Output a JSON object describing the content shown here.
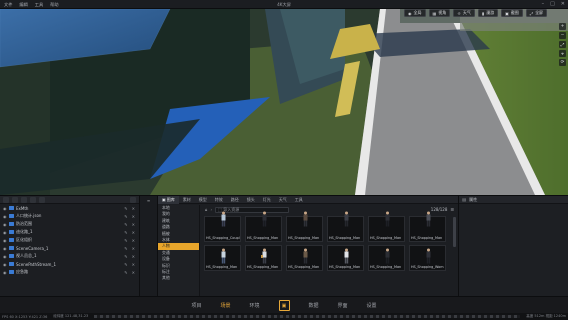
{
  "titlebar": {
    "menu": [
      "文件",
      "编辑",
      "工具",
      "帮助"
    ],
    "title": "4K大屏",
    "controls": [
      "–",
      "□",
      "✕"
    ]
  },
  "viewport": {
    "top_buttons": [
      {
        "icon": "camera-icon",
        "label": "全局"
      },
      {
        "icon": "grid-icon",
        "label": "视角"
      },
      {
        "icon": "sun-icon",
        "label": "天气"
      },
      {
        "icon": "bookmark-icon",
        "label": "漫游"
      },
      {
        "icon": "photo-icon",
        "label": "截图"
      },
      {
        "icon": "expand-icon",
        "label": "全屏"
      }
    ],
    "side_buttons": [
      "+",
      "−",
      "⤢",
      "⌖",
      "⟳"
    ]
  },
  "scene_panel": {
    "items": [
      "ExMth",
      "人口统计.json",
      "防治范围",
      "迪化路_1",
      "区化组织",
      "SceneCamera_1",
      "视人员总_1",
      "ScenePathStream_1",
      "应急路"
    ]
  },
  "library": {
    "tabs": [
      "图库",
      "素材",
      "模型",
      "特效",
      "路径",
      "镜头",
      "灯光",
      "天气",
      "工具"
    ],
    "active_tab": 0,
    "categories": [
      "本地",
      "我的",
      "建筑",
      "道路",
      "植被",
      "水体",
      "人物",
      "交通",
      "设备",
      "标识",
      "标注",
      "其他"
    ],
    "active_category": 6,
    "search_placeholder": "导入资源",
    "count": "128/128",
    "assets": [
      "HS_Shopping_Coupl",
      "HS_Shopping_Man",
      "HS_Shopping_Man",
      "HS_Shopping_Man",
      "HS_Shopping_Man",
      "HS_Shopping_Man",
      "HS_Shopping_Man",
      "HS_Shopping_Man",
      "HS_Shopping_Man",
      "HS_Shopping_Man",
      "HS_Shopping_Man",
      "HS_Shopping_Wom"
    ]
  },
  "properties": {
    "title": "属性"
  },
  "navbar": {
    "items": [
      "项目",
      "场景",
      "环境",
      "▣",
      "数据",
      "界面",
      "设置"
    ],
    "active": 1
  },
  "statusbar": {
    "left": "FPS 60  X:1253  Y:421  Z:36",
    "mid": "经纬度  121.48,31.23",
    "right": "高度 512m  视距 1240m"
  }
}
